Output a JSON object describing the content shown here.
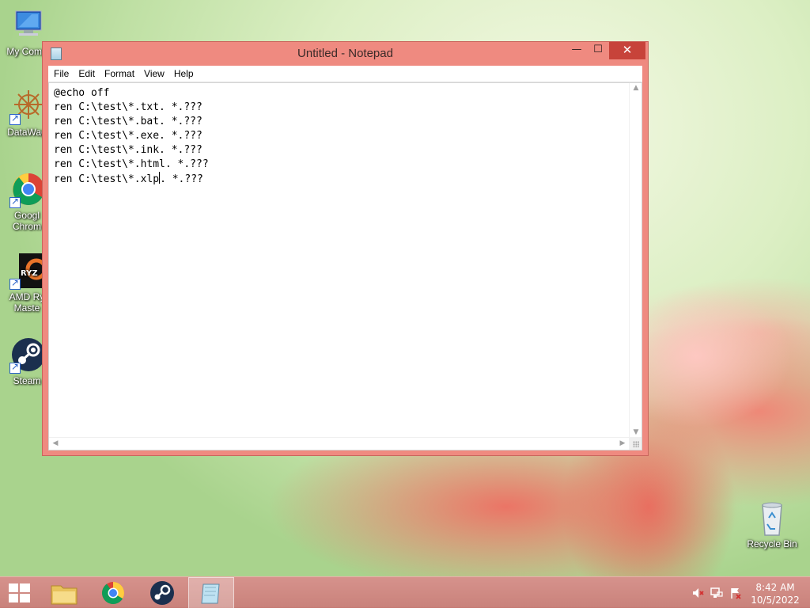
{
  "desktop": {
    "icons": [
      {
        "label": "My Comp"
      },
      {
        "label": "DataWag"
      },
      {
        "label_line1": "Googl",
        "label_line2": "Chrom"
      },
      {
        "label_line1": "AMD Ry",
        "label_line2": "Maste"
      },
      {
        "label": "Steam"
      },
      {
        "label": "Recycle Bin"
      }
    ]
  },
  "window": {
    "title": "Untitled - Notepad",
    "buttons": {
      "minimize": "—",
      "maximize": "☐",
      "close": "✕"
    },
    "menu": [
      "File",
      "Edit",
      "Format",
      "View",
      "Help"
    ],
    "lines": [
      "@echo off",
      "ren C:\\test\\*.txt. *.???",
      "ren C:\\test\\*.bat. *.???",
      "ren C:\\test\\*.exe. *.???",
      "ren C:\\test\\*.ink. *.???",
      "ren C:\\test\\*.html. *.???"
    ],
    "last_line_before_caret": "ren C:\\test\\*.xlp",
    "last_line_after_caret": ". *.???"
  },
  "taskbar": {
    "clock_time": "8:42 AM",
    "clock_date": "10/5/2022"
  }
}
